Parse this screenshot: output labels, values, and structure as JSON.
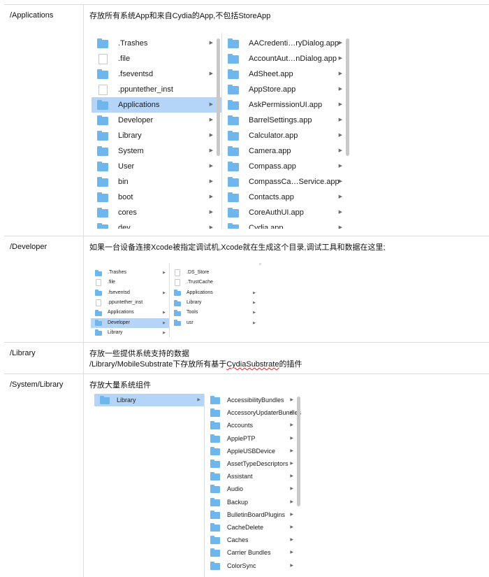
{
  "rows": [
    {
      "path": "/Applications",
      "desc": [
        "存放所有系统App和来自Cydia的App,不包括StoreApp"
      ],
      "finder": {
        "columns": [
          {
            "items": [
              {
                "name": ".Trashes",
                "icon": "folder-icon",
                "arrow": true
              },
              {
                "name": ".file",
                "icon": "file-icon",
                "arrow": false
              },
              {
                "name": ".fseventsd",
                "icon": "folder-icon",
                "arrow": true
              },
              {
                "name": ".ppuntether_inst",
                "icon": "file-icon",
                "arrow": false
              },
              {
                "name": "Applications",
                "icon": "folder-icon",
                "arrow": true,
                "selected": true
              },
              {
                "name": "Developer",
                "icon": "folder-icon",
                "arrow": true
              },
              {
                "name": "Library",
                "icon": "folder-icon",
                "arrow": true
              },
              {
                "name": "System",
                "icon": "folder-icon",
                "arrow": true
              },
              {
                "name": "User",
                "icon": "folder-icon",
                "arrow": true
              },
              {
                "name": "bin",
                "icon": "folder-icon",
                "arrow": true
              },
              {
                "name": "boot",
                "icon": "folder-icon",
                "arrow": true
              },
              {
                "name": "cores",
                "icon": "folder-icon",
                "arrow": true
              },
              {
                "name": "dev",
                "icon": "folder-icon",
                "arrow": true
              }
            ]
          },
          {
            "items": [
              {
                "name": "AACredenti…ryDialog.app",
                "icon": "folder-icon",
                "arrow": true
              },
              {
                "name": "AccountAut…nDialog.app",
                "icon": "folder-icon",
                "arrow": true
              },
              {
                "name": "AdSheet.app",
                "icon": "folder-icon",
                "arrow": true
              },
              {
                "name": "AppStore.app",
                "icon": "folder-icon",
                "arrow": true
              },
              {
                "name": "AskPermissionUI.app",
                "icon": "folder-icon",
                "arrow": true
              },
              {
                "name": "BarrelSettings.app",
                "icon": "folder-icon",
                "arrow": true
              },
              {
                "name": "Calculator.app",
                "icon": "folder-icon",
                "arrow": true
              },
              {
                "name": "Camera.app",
                "icon": "folder-icon",
                "arrow": true
              },
              {
                "name": "Compass.app",
                "icon": "folder-icon",
                "arrow": true
              },
              {
                "name": "CompassCa…Service.app",
                "icon": "folder-icon",
                "arrow": true
              },
              {
                "name": "Contacts.app",
                "icon": "folder-icon",
                "arrow": true
              },
              {
                "name": "CoreAuthUI.app",
                "icon": "folder-icon",
                "arrow": true
              },
              {
                "name": "Cydia.app",
                "icon": "folder-icon",
                "arrow": true
              }
            ]
          }
        ]
      }
    },
    {
      "path": "/Developer",
      "desc": [
        "如果一台设备连接Xcode被指定调试机,Xcode就在生成这个目录,调试工具和数据在这里;"
      ],
      "finder": {
        "columns": [
          {
            "items": [
              {
                "name": ".Trashes",
                "icon": "folder-icon",
                "arrow": true
              },
              {
                "name": ".file",
                "icon": "file-icon",
                "arrow": false
              },
              {
                "name": ".fseventsd",
                "icon": "folder-icon",
                "arrow": true
              },
              {
                "name": ".ppuntether_inst",
                "icon": "file-icon",
                "arrow": false
              },
              {
                "name": "Applications",
                "icon": "folder-icon",
                "arrow": true
              },
              {
                "name": "Developer",
                "icon": "folder-icon",
                "arrow": true,
                "selected": true
              },
              {
                "name": "Library",
                "icon": "folder-icon",
                "arrow": true
              }
            ]
          },
          {
            "items": [
              {
                "name": ".DS_Store",
                "icon": "file-icon",
                "arrow": false
              },
              {
                "name": ".TrustCache",
                "icon": "file-icon",
                "arrow": false
              },
              {
                "name": "Applications",
                "icon": "folder-icon",
                "arrow": true
              },
              {
                "name": "Library",
                "icon": "folder-icon",
                "arrow": true
              },
              {
                "name": "Tools",
                "icon": "folder-icon",
                "arrow": true
              },
              {
                "name": "usr",
                "icon": "folder-icon",
                "arrow": true
              }
            ]
          }
        ]
      }
    },
    {
      "path": "/Library",
      "desc": [
        "存放一些提供系统支持的数据",
        "/Library/MobileSubstrate下存放所有基于CydiaSubstrate的插件"
      ],
      "wavy_word": "CydiaSubstrate"
    },
    {
      "path": "/System/Library",
      "desc": [
        "存放大量系统组件"
      ],
      "finder": {
        "columns": [
          {
            "items": [
              {
                "name": "Library",
                "icon": "folder-icon",
                "arrow": true,
                "selected": true
              }
            ]
          },
          {
            "items": [
              {
                "name": "AccessibilityBundles",
                "icon": "folder-icon",
                "arrow": true
              },
              {
                "name": "AccessoryUpdaterBundles",
                "icon": "folder-icon",
                "arrow": true
              },
              {
                "name": "Accounts",
                "icon": "folder-icon",
                "arrow": true
              },
              {
                "name": "ApplePTP",
                "icon": "folder-icon",
                "arrow": true
              },
              {
                "name": "AppleUSBDevice",
                "icon": "folder-icon",
                "arrow": true
              },
              {
                "name": "AssetTypeDescriptors",
                "icon": "folder-icon",
                "arrow": true
              },
              {
                "name": "Assistant",
                "icon": "folder-icon",
                "arrow": true
              },
              {
                "name": "Audio",
                "icon": "folder-icon",
                "arrow": true
              },
              {
                "name": "Backup",
                "icon": "folder-icon",
                "arrow": true
              },
              {
                "name": "BulletinBoardPlugins",
                "icon": "folder-icon",
                "arrow": true
              },
              {
                "name": "CacheDelete",
                "icon": "folder-icon",
                "arrow": true
              },
              {
                "name": "Caches",
                "icon": "folder-icon",
                "arrow": true
              },
              {
                "name": "Carrier Bundles",
                "icon": "folder-icon",
                "arrow": true
              },
              {
                "name": "ColorSync",
                "icon": "folder-icon",
                "arrow": true
              }
            ]
          }
        ]
      }
    }
  ],
  "arrow_glyph": "▶",
  "colors": {
    "selection": "#b5d5f8",
    "folder": "#6eb6ec",
    "border": "#dcdcdc"
  }
}
